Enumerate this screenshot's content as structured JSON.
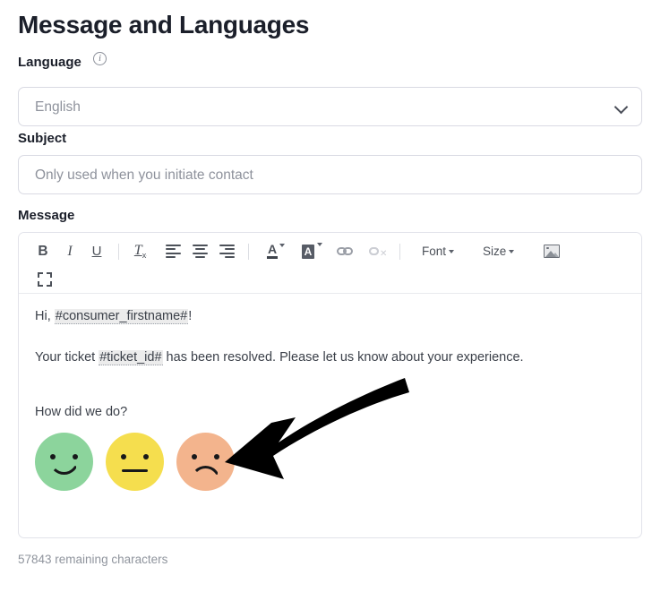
{
  "page": {
    "title": "Message and Languages"
  },
  "language_field": {
    "label": "Language",
    "info_icon": "info-circle-icon",
    "value": "English",
    "chevron_icon": "chevron-down-icon"
  },
  "subject_field": {
    "label": "Subject",
    "value": "",
    "placeholder": "Only used when you initiate contact"
  },
  "message_field": {
    "label": "Message",
    "char_count": "57843 remaining characters"
  },
  "toolbar": {
    "row1": [
      {
        "name": "bold-button",
        "label": "B",
        "icon": "bold-icon"
      },
      {
        "name": "italic-button",
        "label": "I",
        "icon": "italic-icon"
      },
      {
        "name": "underline-button",
        "label": "U",
        "icon": "underline-icon"
      },
      {
        "name": "remove-format-button",
        "label": "T",
        "sub": "x",
        "icon": "remove-format-icon"
      },
      {
        "name": "align-left-button",
        "label": "",
        "icon": "align-left-icon"
      },
      {
        "name": "align-center-button",
        "label": "",
        "icon": "align-center-icon"
      },
      {
        "name": "align-right-button",
        "label": "",
        "icon": "align-right-icon"
      },
      {
        "name": "font-color-button",
        "label": "A",
        "icon": "font-color-icon"
      },
      {
        "name": "background-color-button",
        "label": "A",
        "icon": "background-color-icon"
      },
      {
        "name": "link-button",
        "label": "",
        "icon": "link-icon"
      },
      {
        "name": "unlink-button",
        "label": "",
        "icon": "unlink-icon"
      },
      {
        "name": "font-dropdown",
        "label": "Font",
        "icon": "caret-down-icon"
      },
      {
        "name": "size-dropdown",
        "label": "Size",
        "icon": "caret-down-icon"
      },
      {
        "name": "insert-image-button",
        "label": "",
        "icon": "image-icon"
      }
    ],
    "font_label": "Font",
    "size_label": "Size",
    "fullscreen_icon": "fullscreen-icon"
  },
  "message_body": {
    "greeting_prefix": "Hi, ",
    "greeting_token": "#consumer_firstname#",
    "greeting_suffix": "!",
    "ticket_prefix": "Your ticket ",
    "ticket_token": "#ticket_id#",
    "ticket_suffix": " has been resolved. Please let us know about your experience.",
    "rating_prompt": "How did we do?",
    "faces": [
      {
        "name": "happy-face",
        "mood": "happy",
        "color": "#8cd49c"
      },
      {
        "name": "neutral-face",
        "mood": "neutral",
        "color": "#f5de4e"
      },
      {
        "name": "sad-face",
        "mood": "sad",
        "color": "#f3b48d"
      }
    ]
  },
  "annotation": {
    "arrow_icon": "annotation-arrow-icon",
    "arrow_color": "#000000"
  },
  "colors": {
    "text_primary": "#1b1f2a",
    "text_muted": "#8e929c",
    "border": "#d9dae3",
    "editor_border": "#e2e3ea"
  }
}
